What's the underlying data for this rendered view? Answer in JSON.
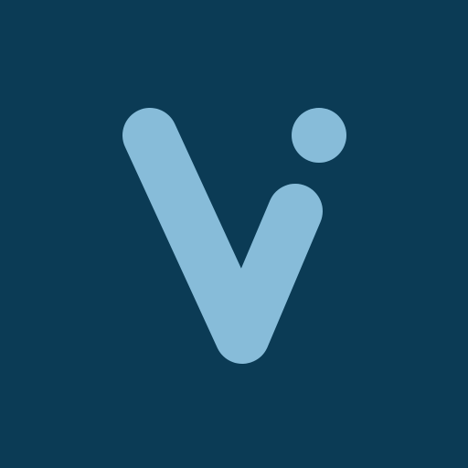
{
  "app_icon": {
    "name": "vi-logo",
    "colors": {
      "background": "#0b3b55",
      "mark": "#87bcd9"
    }
  }
}
